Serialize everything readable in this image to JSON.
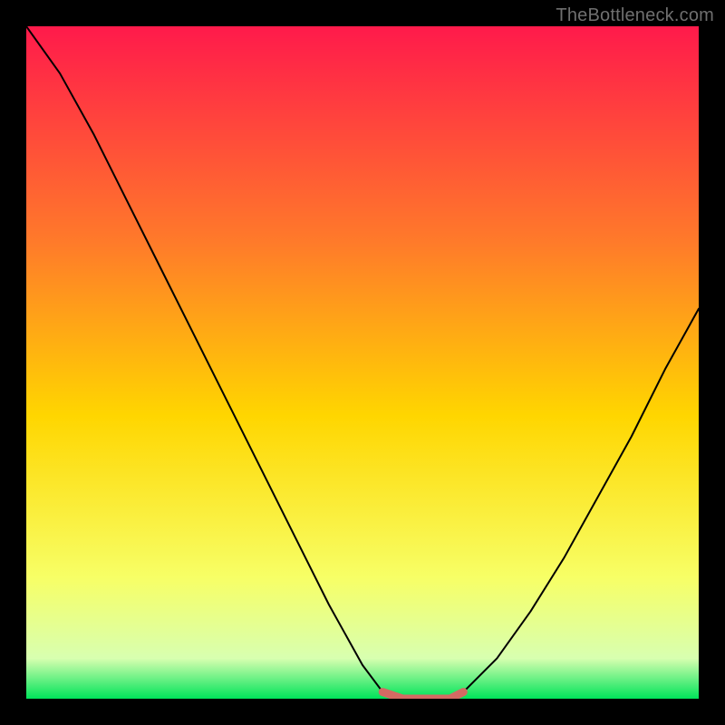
{
  "attribution": "TheBottleneck.com",
  "colors": {
    "frame": "#000000",
    "gradient_top": "#ff1a4b",
    "gradient_mid_upper": "#ff7a2a",
    "gradient_mid": "#ffd600",
    "gradient_lower": "#f7ff66",
    "gradient_near_bottom": "#d8ffb0",
    "gradient_bottom": "#00e35a",
    "curve": "#000000",
    "highlight": "#d46a63"
  },
  "chart_data": {
    "type": "line",
    "title": "",
    "xlabel": "",
    "ylabel": "",
    "xlim": [
      0,
      100
    ],
    "ylim": [
      0,
      100
    ],
    "grid": false,
    "series": [
      {
        "name": "bottleneck-curve",
        "x": [
          0,
          5,
          10,
          15,
          20,
          25,
          30,
          35,
          40,
          45,
          50,
          53,
          56,
          58,
          60,
          63,
          65,
          70,
          75,
          80,
          85,
          90,
          95,
          100
        ],
        "y": [
          100,
          93,
          84,
          74,
          64,
          54,
          44,
          34,
          24,
          14,
          5,
          1,
          0,
          0,
          0,
          0,
          1,
          6,
          13,
          21,
          30,
          39,
          49,
          58
        ]
      }
    ],
    "highlight_segment": {
      "name": "optimal-range",
      "x": [
        53,
        56,
        58,
        60,
        63,
        65
      ],
      "y": [
        1,
        0,
        0,
        0,
        0,
        1
      ]
    }
  }
}
